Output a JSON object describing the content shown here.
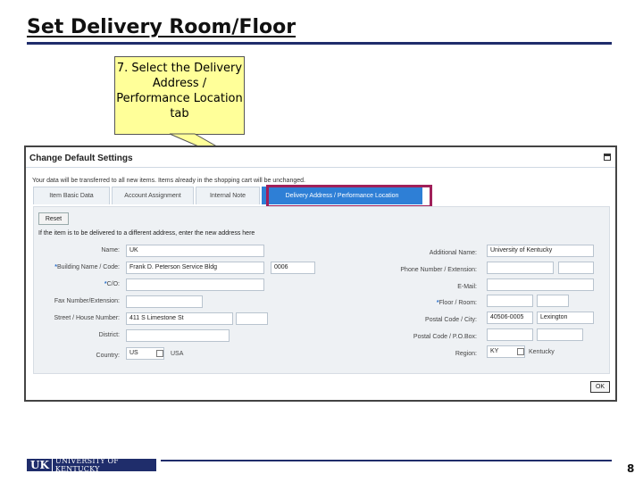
{
  "slide": {
    "title": "Set Delivery Room/Floor",
    "callout": "7. Select the Delivery Address / Performance Location tab",
    "page_number": "8",
    "logo_uk": "UK",
    "logo_text": "UNIVERSITY OF KENTUCKY"
  },
  "dialog": {
    "title": "Change Default Settings",
    "info": "Your data will be transferred to all new items. Items already in the shopping cart will be unchanged.",
    "tabs": [
      {
        "label": "Item Basic Data",
        "active": false
      },
      {
        "label": "Account Assignment",
        "active": false
      },
      {
        "label": "Internal Note",
        "active": false
      },
      {
        "label": "Delivery Address / Performance Location",
        "active": true
      }
    ],
    "reset_label": "Reset",
    "instruction": "If the item is to be delivered to a different address, enter the new address here",
    "ok_label": "OK",
    "required_marker": "*",
    "left_fields": {
      "name": {
        "label": "Name:",
        "value": "UK"
      },
      "building": {
        "label": "Building Name / Code:",
        "value": "Frank D. Peterson Service Bldg",
        "code": "0006"
      },
      "co": {
        "label": "C/O:",
        "value": ""
      },
      "fax": {
        "label": "Fax Number/Extension:",
        "value": ""
      },
      "street": {
        "label": "Street / House Number:",
        "value": "411 S Limestone St",
        "house": ""
      },
      "district": {
        "label": "District:",
        "value": ""
      },
      "country": {
        "label": "Country:",
        "value": "US",
        "name": "USA"
      }
    },
    "right_fields": {
      "additional_name": {
        "label": "Additional Name:",
        "value": "University of Kentucky"
      },
      "phone": {
        "label": "Phone Number / Extension:",
        "value": "",
        "ext": ""
      },
      "email": {
        "label": "E-Mail:",
        "value": ""
      },
      "floor": {
        "label": "Floor / Room:",
        "value": "",
        "room": ""
      },
      "postal_city": {
        "label": "Postal Code / City:",
        "postal": "40506-0005",
        "city": "Lexington"
      },
      "po_box": {
        "label": "Postal Code / P.O.Box:",
        "postal": "",
        "box": ""
      },
      "region": {
        "label": "Region:",
        "value": "KY",
        "name": "Kentucky"
      }
    }
  }
}
